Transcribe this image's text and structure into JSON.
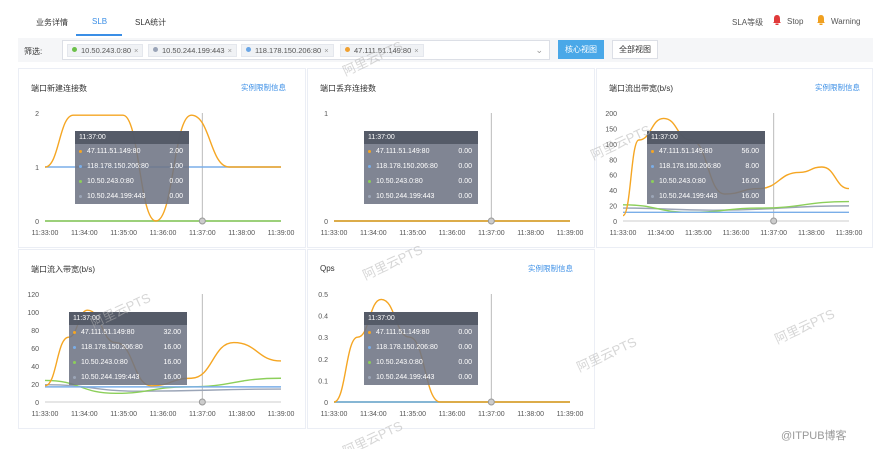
{
  "tabs": [
    {
      "label": "业务详情",
      "active": false
    },
    {
      "label": "SLB",
      "active": true
    },
    {
      "label": "SLA统计",
      "active": false
    }
  ],
  "sla_legend": {
    "label": "SLA等级",
    "stop": "Stop",
    "warning": "Warning",
    "stop_color": "#e03a3a",
    "warning_color": "#f0a020"
  },
  "filter": {
    "label": "筛选:",
    "tags": [
      {
        "label": "10.50.243.0:80",
        "color": "#6cc04a"
      },
      {
        "label": "10.50.244.199:443",
        "color": "#9aa4b8"
      },
      {
        "label": "118.178.150.206:80",
        "color": "#6aa6e6"
      },
      {
        "label": "47.111.51.149:80",
        "color": "#f0a030"
      }
    ],
    "chevron": "chevron-down-icon",
    "btn_core": "核心视图",
    "btn_all": "全部视图"
  },
  "colors": {
    "orange": "#f5a623",
    "blue": "#7aaee8",
    "green": "#8ccf5a",
    "gray": "#9ba5b7",
    "accent": "#3a8ee6"
  },
  "tooltip_time": "11:37:00",
  "x_ticks": [
    "11:33:00",
    "11:34:00",
    "11:35:00",
    "11:36:00",
    "11:37:00",
    "11:38:00",
    "11:39:00"
  ],
  "panels": [
    {
      "title": "端口新建连接数",
      "link": "实例限制信息",
      "y_ticks": [
        "0",
        "1",
        "2"
      ],
      "tooltip": [
        {
          "name": "47.111.51.149:80",
          "value": "2.00",
          "color": "#f5a623"
        },
        {
          "name": "118.178.150.206:80",
          "value": "1.00",
          "color": "#7aaee8"
        },
        {
          "name": "10.50.243.0:80",
          "value": "0.00",
          "color": "#8ccf5a"
        },
        {
          "name": "10.50.244.199:443",
          "value": "0.00",
          "color": "#9ba5b7"
        }
      ]
    },
    {
      "title": "端口丢弃连接数",
      "link": "",
      "y_ticks": [
        "0",
        "1"
      ],
      "tooltip": [
        {
          "name": "47.111.51.149:80",
          "value": "0.00",
          "color": "#f5a623"
        },
        {
          "name": "118.178.150.206:80",
          "value": "0.00",
          "color": "#7aaee8"
        },
        {
          "name": "10.50.243.0:80",
          "value": "0.00",
          "color": "#8ccf5a"
        },
        {
          "name": "10.50.244.199:443",
          "value": "0.00",
          "color": "#9ba5b7"
        }
      ]
    },
    {
      "title": "端口流出带宽(b/s)",
      "link": "实例限制信息",
      "y_ticks": [
        "0",
        "20",
        "40",
        "60",
        "80",
        "100",
        "150",
        "200"
      ],
      "tooltip": [
        {
          "name": "47.111.51.149:80",
          "value": "56.00",
          "color": "#f5a623"
        },
        {
          "name": "118.178.150.206:80",
          "value": "8.00",
          "color": "#7aaee8"
        },
        {
          "name": "10.50.243.0:80",
          "value": "16.00",
          "color": "#8ccf5a"
        },
        {
          "name": "10.50.244.199:443",
          "value": "16.00",
          "color": "#9ba5b7"
        }
      ]
    },
    {
      "title": "端口流入带宽(b/s)",
      "link": "",
      "y_ticks": [
        "0",
        "20",
        "40",
        "60",
        "80",
        "100",
        "120"
      ],
      "tooltip": [
        {
          "name": "47.111.51.149:80",
          "value": "32.00",
          "color": "#f5a623"
        },
        {
          "name": "118.178.150.206:80",
          "value": "16.00",
          "color": "#7aaee8"
        },
        {
          "name": "10.50.243.0:80",
          "value": "16.00",
          "color": "#8ccf5a"
        },
        {
          "name": "10.50.244.199:443",
          "value": "16.00",
          "color": "#9ba5b7"
        }
      ]
    },
    {
      "title": "Qps",
      "link": "实例限制信息",
      "y_ticks": [
        "0",
        "0.1",
        "0.2",
        "0.3",
        "0.4",
        "0.5"
      ],
      "tooltip": [
        {
          "name": "47.111.51.149:80",
          "value": "0.00",
          "color": "#f5a623"
        },
        {
          "name": "118.178.150.206:80",
          "value": "0.00",
          "color": "#7aaee8"
        },
        {
          "name": "10.50.243.0:80",
          "value": "0.00",
          "color": "#8ccf5a"
        },
        {
          "name": "10.50.244.199:443",
          "value": "0.00",
          "color": "#9ba5b7"
        }
      ]
    }
  ],
  "watermark_text": "阿里云PTS",
  "footer_mark": "@ITPUB博客"
}
